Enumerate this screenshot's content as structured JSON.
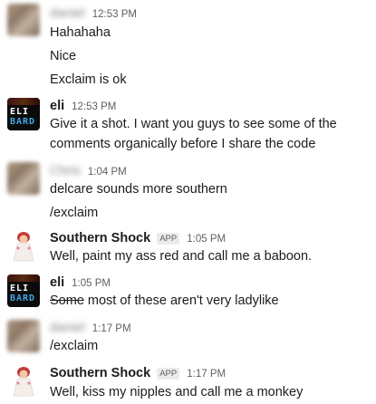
{
  "messages": [
    {
      "author": "daniel",
      "time": "12:53 PM",
      "lines": [
        "Hahahaha",
        "Nice",
        "Exclaim is ok"
      ]
    },
    {
      "author": "eli",
      "time": "12:53 PM",
      "lines": [
        "Give it a shot. I want you guys to see some of the",
        "comments organically before I share the code"
      ]
    },
    {
      "author": "Chris",
      "time": "1:04 PM",
      "lines": [
        "delcare sounds more southern",
        "/exclaim"
      ]
    },
    {
      "author": "Southern Shock",
      "badge": "APP",
      "time": "1:05 PM",
      "lines": [
        "Well, paint my ass red and call me a baboon."
      ]
    },
    {
      "author": "eli",
      "time": "1:05 PM",
      "strike": "Some",
      "lines": [
        " most of these aren't very ladylike"
      ]
    },
    {
      "author": "daniel",
      "time": "1:17 PM",
      "lines": [
        "/exclaim"
      ]
    },
    {
      "author": "Southern Shock",
      "badge": "APP",
      "time": "1:17 PM",
      "lines": [
        "Well, kiss my nipples and call me a monkey"
      ]
    }
  ],
  "avatars": {
    "eli": {
      "top": "ELI",
      "bottom": "BARD",
      "colors": {
        "top": "#ffffff",
        "bottom": "#3fa9e6"
      }
    }
  }
}
